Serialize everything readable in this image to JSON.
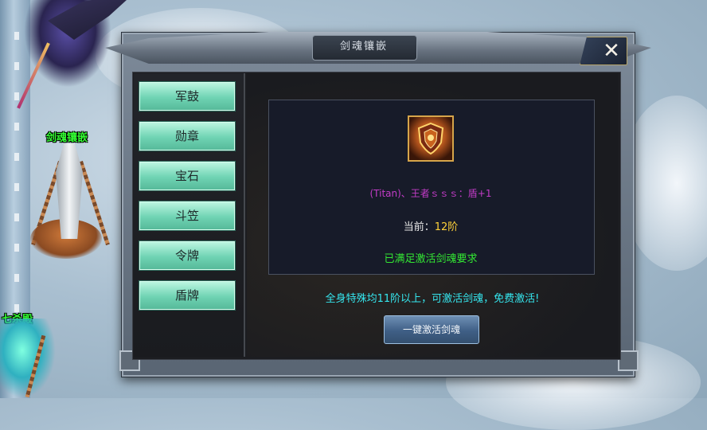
{
  "scene": {
    "npc_names": [
      "剑魂镶嵌",
      "七杀殿"
    ]
  },
  "dialog": {
    "title": "剑魂镶嵌",
    "close_label": "✕"
  },
  "sidebar": {
    "items": [
      {
        "label": "军鼓"
      },
      {
        "label": "勋章"
      },
      {
        "label": "宝石"
      },
      {
        "label": "斗笠"
      },
      {
        "label": "令牌"
      },
      {
        "label": "盾牌"
      }
    ]
  },
  "detail": {
    "icon": "shield-emblem-icon",
    "effect_text": "(Titan)、王者ｓｓｓ：盾+1",
    "current_label": "当前：",
    "current_level": "12阶",
    "status_text": "已满足激活剑魂要求"
  },
  "notice": "全身特殊均11阶以上，可激活剑魂，免费激活!",
  "activate_button": "一键激活剑魂",
  "colors": {
    "menu_button": "#6fd3b3",
    "effect_text": "#c33cc8",
    "level_text": "#ffd23a",
    "status_text": "#33e833",
    "notice_text": "#35e6ee"
  }
}
